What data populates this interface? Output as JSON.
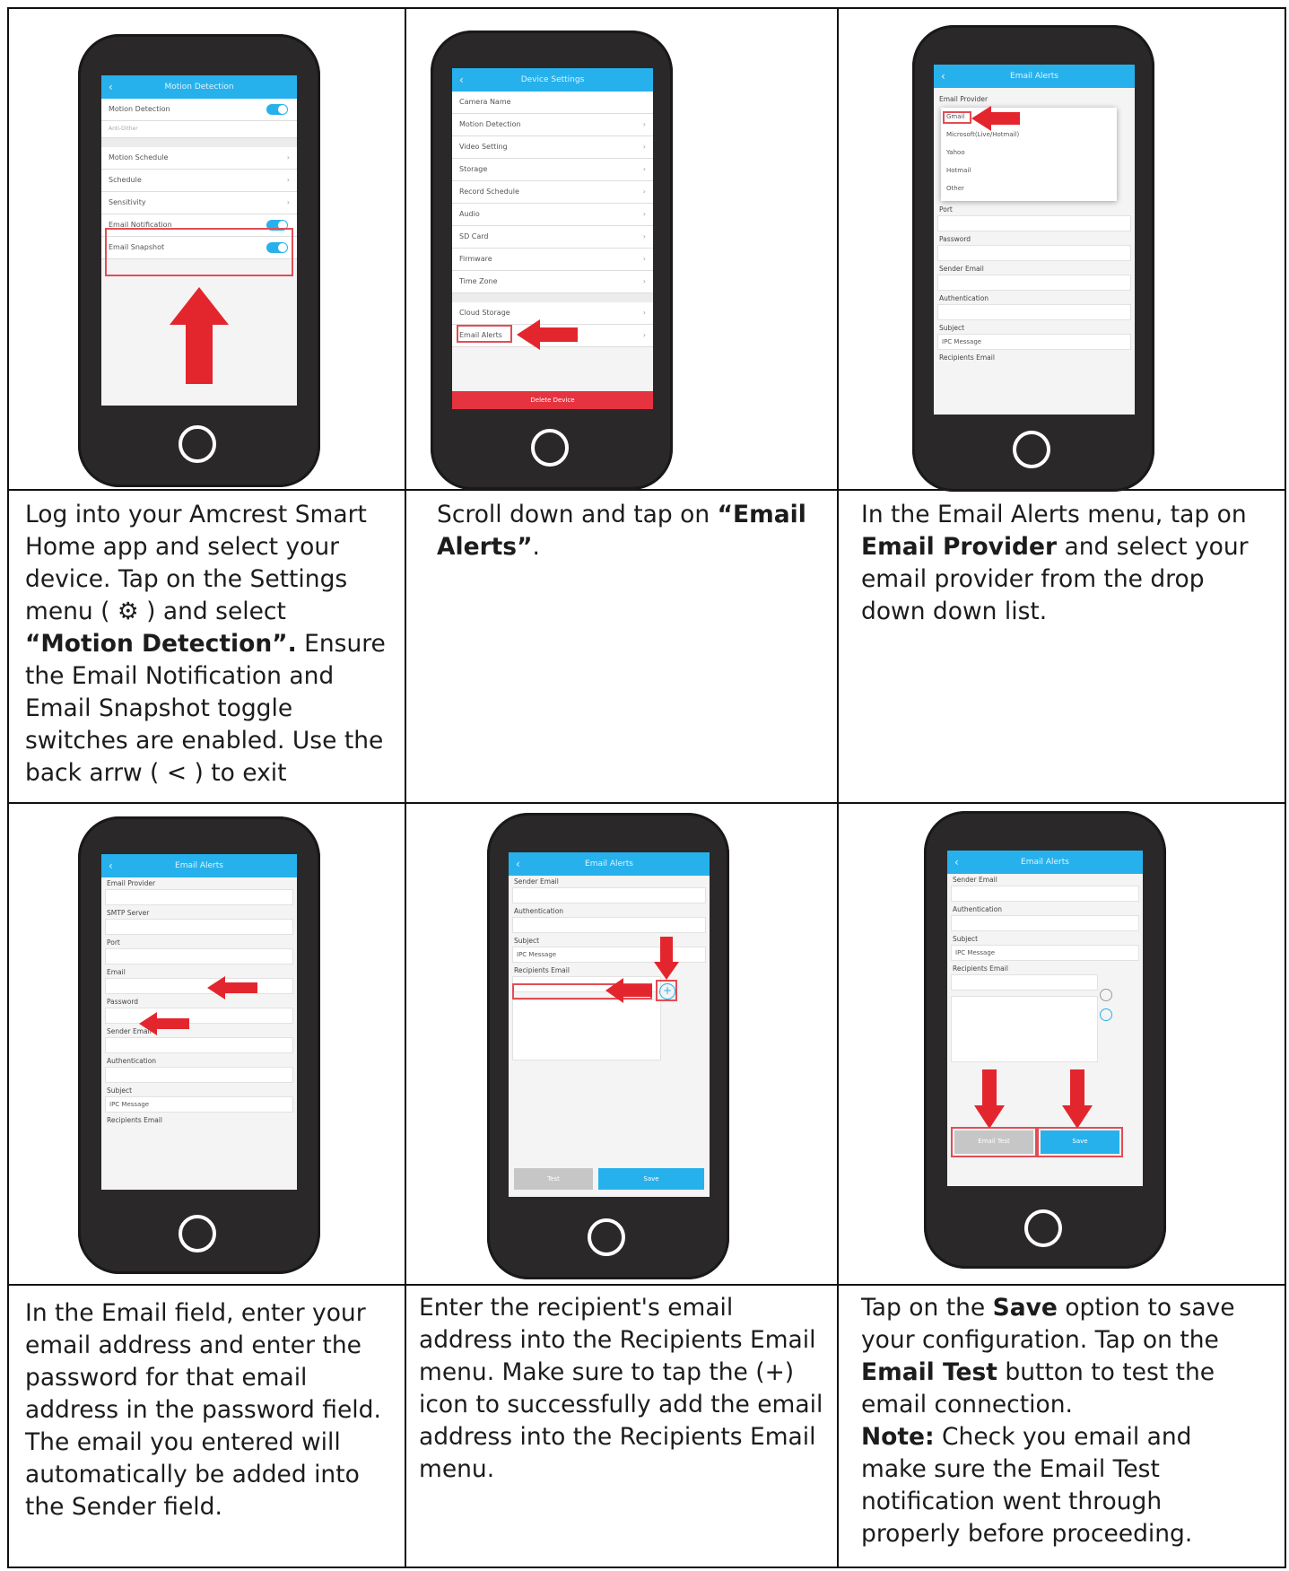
{
  "steps": [
    {
      "screen": {
        "title": "Motion Detection",
        "rows": [
          "Motion Detection",
          "Anti-Dither",
          "Motion Schedule",
          "Schedule",
          "Sensitivity",
          "Email Notification",
          "Email Snapshot"
        ]
      },
      "text_parts": [
        {
          "t": "Log into your Amcrest Smart Home app and select your device. Tap on the Settings menu ( "
        },
        {
          "t": "⚙",
          "icon": "gear-icon"
        },
        {
          "t": " ) and select "
        },
        {
          "t": "“Motion Detection”.",
          "bold": true
        },
        {
          "t": " Ensure the Email Notification and Email Snapshot toggle switches are enabled. Use the back arrw ( < ) to exit"
        }
      ]
    },
    {
      "screen": {
        "title": "Device Settings",
        "rows": [
          "Camera Name",
          "Motion Detection",
          "Video Setting",
          "Storage",
          "Record Schedule",
          "Audio",
          "SD Card",
          "Firmware",
          "Time Zone",
          "Cloud Storage",
          "Email Alerts"
        ],
        "bottom_button": "Delete Device"
      },
      "text_parts": [
        {
          "t": "Scroll down and tap on "
        },
        {
          "t": "“Email Alerts”",
          "bold": true
        },
        {
          "t": "."
        }
      ]
    },
    {
      "screen": {
        "title": "Email Alerts",
        "dropdown": [
          "Gmail",
          "Microsoft(Live/Hotmail)",
          "Yahoo",
          "Hotmail",
          "Other"
        ],
        "fields": [
          "Email Provider",
          "Port",
          "Password",
          "Sender Email",
          "Authentication",
          "Subject",
          "IPC Message",
          "Recipients Email"
        ]
      },
      "text_parts": [
        {
          "t": "In the Email Alerts menu, tap on "
        },
        {
          "t": "Email Provider",
          "bold": true
        },
        {
          "t": " and select your email provider from the drop down down list."
        }
      ]
    },
    {
      "screen": {
        "title": "Email Alerts",
        "fields": [
          "Email Provider",
          "SMTP Server",
          "Port",
          "Email",
          "Password",
          "Sender Email",
          "Authentication",
          "Subject",
          "IPC Message",
          "Recipients Email"
        ]
      },
      "text_parts": [
        {
          "t": "In the Email field, enter your email address and enter the password for that email address in the password field. The email you entered will automatically be added into the Sender field."
        }
      ]
    },
    {
      "screen": {
        "title": "Email Alerts",
        "fields": [
          "Sender Email",
          "Authentication",
          "Subject",
          "IPC Message",
          "Recipients Email"
        ],
        "bottom_buttons": [
          "Test",
          "Save"
        ]
      },
      "text_parts": [
        {
          "t": "Enter the recipient's email address into the Recipients Email menu. Make sure to tap the (+) icon to successfully add the email address into the Recipients Email menu."
        }
      ]
    },
    {
      "screen": {
        "title": "Email Alerts",
        "fields": [
          "Sender Email",
          "Authentication",
          "Subject",
          "IPC Message",
          "Recipients Email"
        ],
        "bottom_buttons": [
          "Email Test",
          "Save"
        ]
      },
      "text_parts": [
        {
          "t": "Tap on the "
        },
        {
          "t": "Save",
          "bold": true
        },
        {
          "t": " option to save your configuration. Tap on the "
        },
        {
          "t": "Email Test",
          "bold": true
        },
        {
          "t": " button to test the email connection."
        },
        {
          "br": true
        },
        {
          "t": "Note:",
          "bold": true
        },
        {
          "t": " Check you email and make sure the Email Test notification went through properly before proceeding."
        }
      ]
    }
  ],
  "colors": {
    "accent": "#27b1ec",
    "arrow": "#e3262e",
    "highlight": "#e24d55",
    "phone": "#2a2828"
  }
}
